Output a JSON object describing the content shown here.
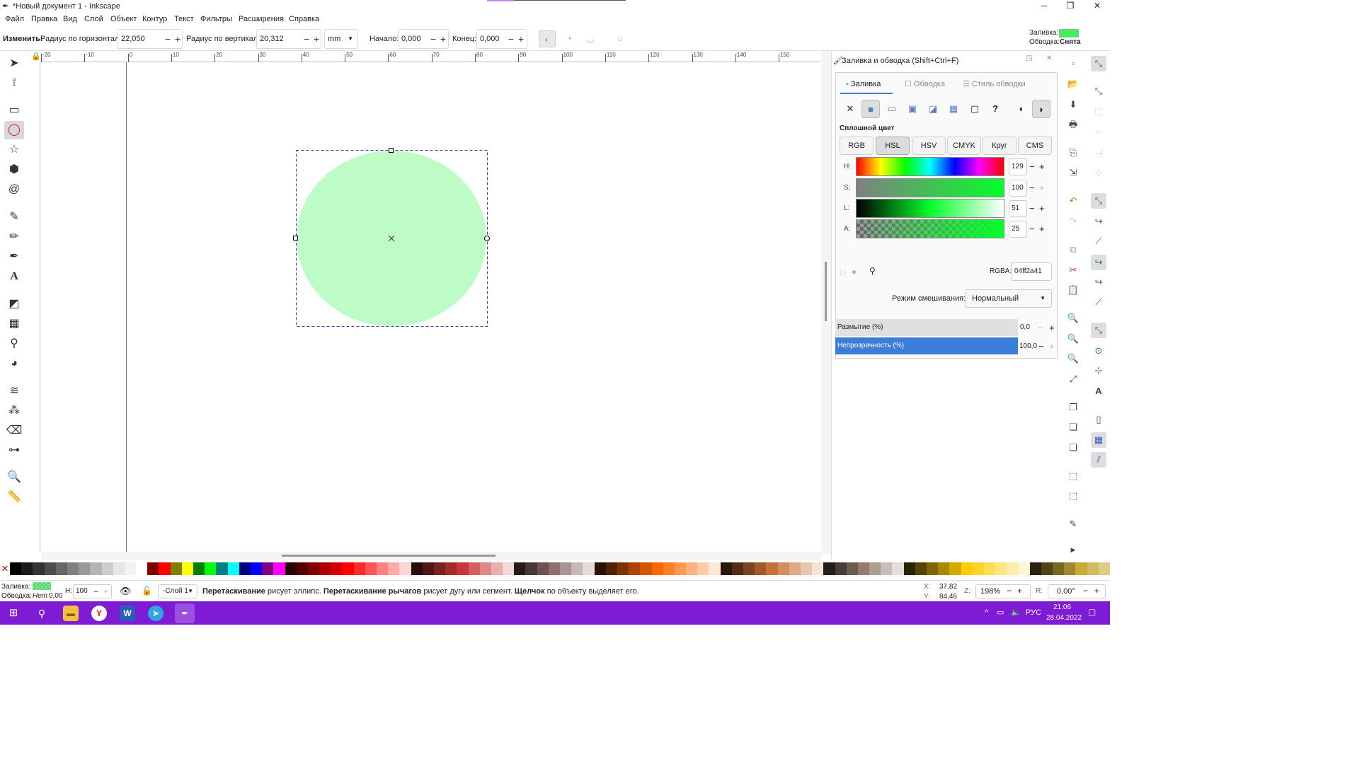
{
  "window": {
    "title": "*Новый документ 1 - Inkscape",
    "minimize": "─",
    "maximize": "❐",
    "close": "✕"
  },
  "menu": [
    "Файл",
    "Правка",
    "Вид",
    "Слой",
    "Объект",
    "Контур",
    "Текст",
    "Фильтры",
    "Расширения",
    "Справка"
  ],
  "toolctl": {
    "change_label": "Изменить:",
    "rx_label": "Радиус по горизонтали:",
    "rx_value": "22,050",
    "ry_label": "Радиус по вертикали:",
    "ry_value": "20,312",
    "unit": "mm",
    "start_label": "Начало:",
    "start_value": "0,000",
    "end_label": "Конец:",
    "end_value": "0,000",
    "minus": "−",
    "plus": "+"
  },
  "style_indicator": {
    "fill_label": "Заливка:",
    "stroke_label": "Обводка:",
    "stroke_value": "Снята",
    "fill_color": "#3cf25a"
  },
  "ruler_labels": [
    "-20",
    "-10",
    "0",
    "10",
    "20",
    "30",
    "40",
    "50",
    "60",
    "70",
    "80",
    "90",
    "100",
    "110",
    "120",
    "130",
    "140",
    "150"
  ],
  "canvas": {
    "ellipse_color": "#bdfcc6",
    "ellipse_icon": "ellipse-shape"
  },
  "dock": {
    "title": "Заливка и обводка (Shift+Ctrl+F)",
    "tabs": [
      "Заливка",
      "Обводка",
      "Стиль обводки"
    ],
    "fill_types": [
      "✕",
      "■",
      "▭",
      "▣",
      "◪",
      "▦",
      "▢",
      "?",
      "◖",
      "◗"
    ],
    "section_title": "Сплошной цвет",
    "modes": [
      "RGB",
      "HSL",
      "HSV",
      "CMYK",
      "Круг",
      "CMS"
    ],
    "active_mode": "HSL",
    "channels": [
      {
        "label": "H:",
        "value": "129"
      },
      {
        "label": "S:",
        "value": "100"
      },
      {
        "label": "L:",
        "value": "51"
      },
      {
        "label": "A:",
        "value": "25"
      }
    ],
    "rgba_label": "RGBA:",
    "rgba_value": "04ff2a41",
    "blend_label": "Режим смешивания:",
    "blend_value": "Нормальный",
    "blur_label": "Размытие (%)",
    "blur_value": "0,0",
    "opacity_label": "Непрозрачность (%)",
    "opacity_value": "100,0"
  },
  "status": {
    "fill_label": "Заливка:",
    "stroke_label": "Обводка:",
    "stroke_value": "Нет",
    "stroke_width": "0,00",
    "h_label": "Н:",
    "h_value": "100",
    "layer": "-Слой 1",
    "msg_b1": "Перетаскивание",
    "msg_t1": " рисует эллипс. ",
    "msg_b2": "Перетаскивание рычагов",
    "msg_t2": " рисует дугу или сегмент. ",
    "msg_b3": "Щелчок",
    "msg_t3": " по объекту выделяет его.",
    "x_label": "X:",
    "x_value": "37,82",
    "y_label": "Y:",
    "y_value": "84,46",
    "z_label": "Z:",
    "zoom": "198%",
    "r_label": "R:",
    "rotation": "0,00°"
  },
  "taskbar": {
    "time": "21:06",
    "date": "28.04.2022",
    "lang": "РУС"
  },
  "palette": [
    "#000000",
    "#1a1a1a",
    "#333333",
    "#4d4d4d",
    "#666666",
    "#808080",
    "#999999",
    "#b3b3b3",
    "#cccccc",
    "#e6e6e6",
    "#f2f2f2",
    "#ffffff",
    "#800000",
    "#ff0000",
    "#808000",
    "#ffff00",
    "#008000",
    "#00ff00",
    "#008080",
    "#00ffff",
    "#000080",
    "#0000ff",
    "#800080",
    "#ff00ff",
    "#2b0000",
    "#550000",
    "#800000",
    "#aa0000",
    "#d40000",
    "#ff0000",
    "#ff2a2a",
    "#ff5555",
    "#ff8080",
    "#ffaaaa",
    "#ffd5d5",
    "#280b0b",
    "#501616",
    "#782121",
    "#a02c2c",
    "#c83737",
    "#d35f5f",
    "#de8787",
    "#e9afaf",
    "#f4d7d7",
    "#241c1c",
    "#483737",
    "#6c5353",
    "#916f6f",
    "#ac9393",
    "#c8b7b7",
    "#e3dbdb",
    "#2b1100",
    "#552200",
    "#803300",
    "#aa4400",
    "#d45500",
    "#ff6600",
    "#ff7f2a",
    "#ff9955",
    "#ffb380",
    "#ffccaa",
    "#ffe6d5",
    "#28170b",
    "#502d16",
    "#784421",
    "#a05a2c",
    "#c87137",
    "#d38d5f",
    "#deaa87",
    "#e9c6af",
    "#f4e3d7",
    "#241f1c",
    "#483e37",
    "#6c5d53",
    "#917c6f",
    "#ac9d93",
    "#c8beb7",
    "#e3dedb",
    "#2b2200",
    "#554400",
    "#806600",
    "#aa8800",
    "#d4aa00",
    "#ffcc00",
    "#ffd42a",
    "#ffdd55",
    "#ffe680",
    "#ffeeaa",
    "#fff6d5",
    "#28220b",
    "#504416",
    "#786721",
    "#a0892c",
    "#c8ab37",
    "#d3bc5f",
    "#decd87"
  ]
}
